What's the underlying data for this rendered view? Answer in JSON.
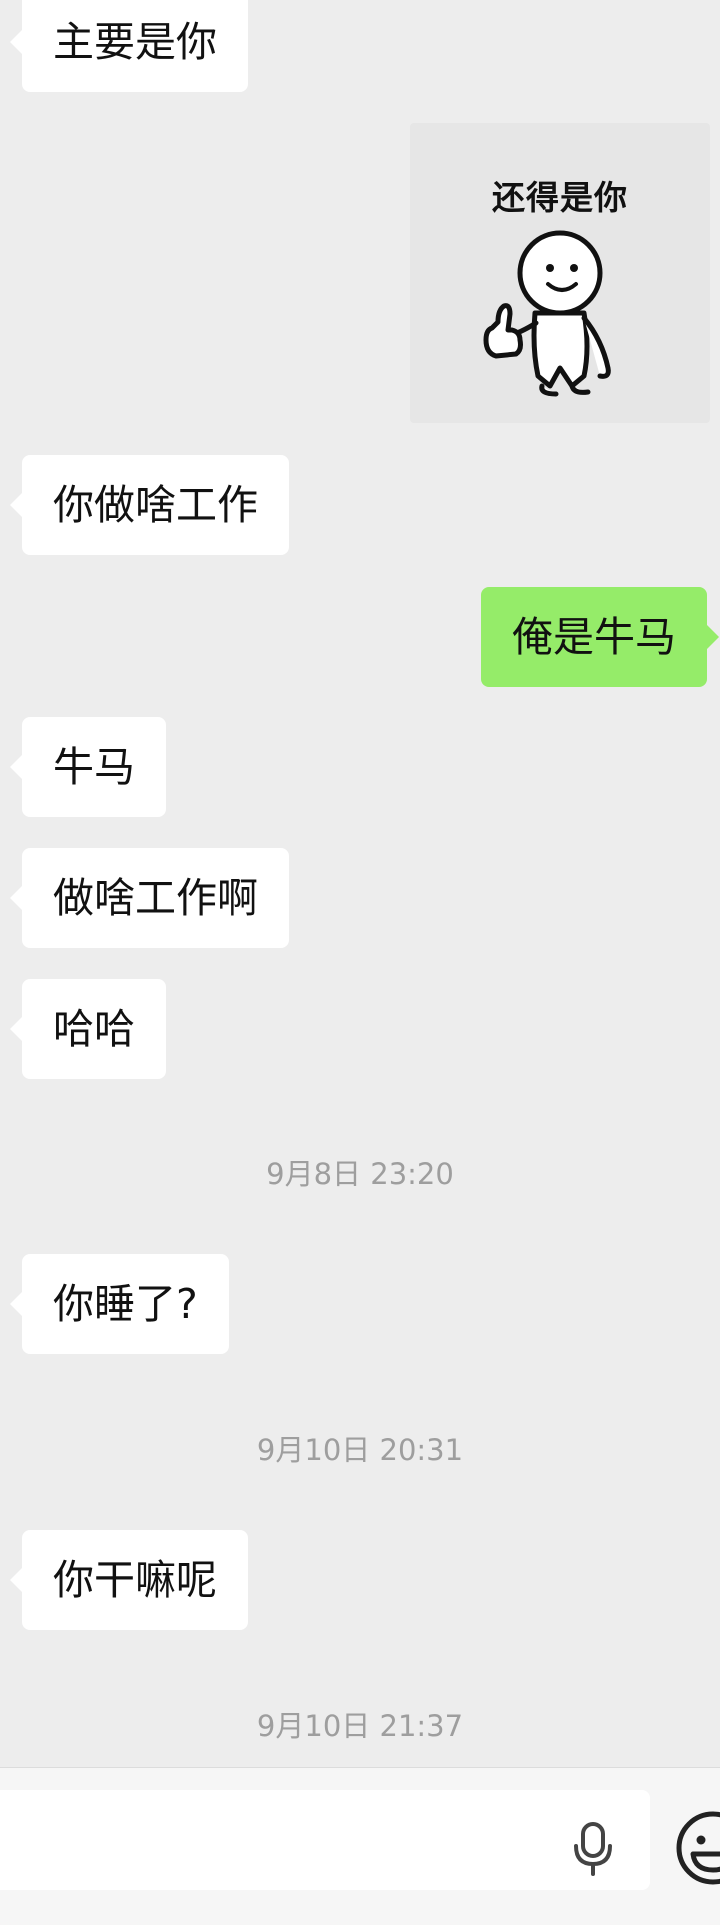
{
  "messages": [
    {
      "side": "left",
      "text": "主要是你"
    },
    {
      "side": "right",
      "type": "sticker",
      "text": "还得是你"
    },
    {
      "side": "left",
      "text": "你做啥工作"
    },
    {
      "side": "right",
      "text": "俺是牛马"
    },
    {
      "side": "left",
      "text": "牛马"
    },
    {
      "side": "left",
      "text": "做啥工作啊"
    },
    {
      "side": "left",
      "text": "哈哈"
    },
    {
      "type": "time",
      "text": "9月8日 23:20"
    },
    {
      "side": "left",
      "text": "你睡了?"
    },
    {
      "type": "time",
      "text": "9月10日 20:31"
    },
    {
      "side": "left",
      "text": "你干嘛呢"
    },
    {
      "type": "time",
      "text": "9月10日 21:37"
    }
  ],
  "colors": {
    "background": "#ededed",
    "incoming_bubble": "#ffffff",
    "outgoing_bubble": "#95ec69",
    "timestamp": "#9e9e9e"
  },
  "input_bar": {
    "icons": [
      "microphone-icon",
      "emoji-icon"
    ]
  }
}
